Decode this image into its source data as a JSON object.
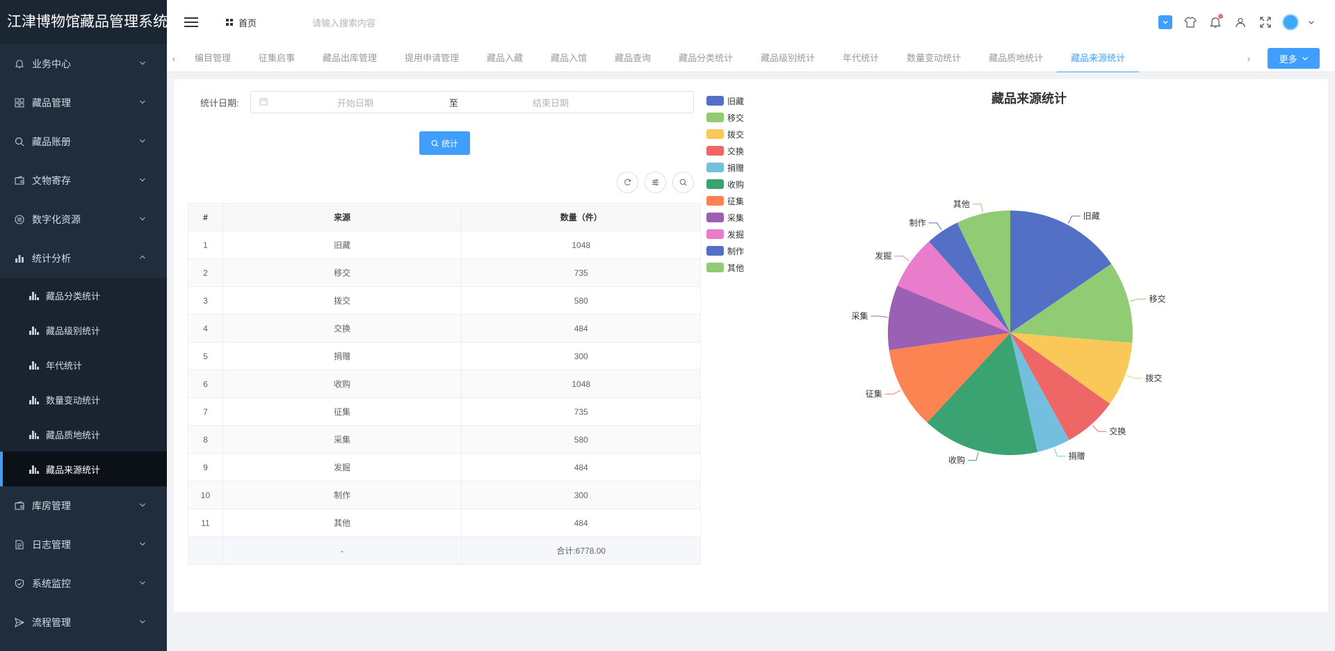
{
  "app_title": "江津博物馆藏品管理系统",
  "sidebar": {
    "items": [
      {
        "label": "业务中心",
        "icon": "bell-icon",
        "expanded": false
      },
      {
        "label": "藏品管理",
        "icon": "grid-icon",
        "expanded": false
      },
      {
        "label": "藏品账册",
        "icon": "search-icon",
        "expanded": false
      },
      {
        "label": "文物寄存",
        "icon": "wallet-icon",
        "expanded": false
      },
      {
        "label": "数字化资源",
        "icon": "list-icon",
        "expanded": false
      },
      {
        "label": "统计分析",
        "icon": "bar-chart-icon",
        "expanded": true
      },
      {
        "label": "库房管理",
        "icon": "wallet-icon",
        "expanded": false
      },
      {
        "label": "日志管理",
        "icon": "document-icon",
        "expanded": false
      },
      {
        "label": "系统监控",
        "icon": "shield-icon",
        "expanded": false
      },
      {
        "label": "流程管理",
        "icon": "send-icon",
        "expanded": false
      }
    ],
    "submenu": [
      {
        "label": "藏品分类统计",
        "active": false
      },
      {
        "label": "藏品级别统计",
        "active": false
      },
      {
        "label": "年代统计",
        "active": false
      },
      {
        "label": "数量变动统计",
        "active": false
      },
      {
        "label": "藏品质地统计",
        "active": false
      },
      {
        "label": "藏品来源统计",
        "active": true
      }
    ]
  },
  "header": {
    "home_label": "首页",
    "search_placeholder": "请输入搜索内容"
  },
  "tabs": {
    "items": [
      "编目管理",
      "征集启事",
      "藏品出库管理",
      "提用申请管理",
      "藏品入藏",
      "藏品入馆",
      "藏品查询",
      "藏品分类统计",
      "藏品级别统计",
      "年代统计",
      "数量变动统计",
      "藏品质地统计",
      "藏品来源统计"
    ],
    "active_index": 12,
    "more_label": "更多"
  },
  "form": {
    "date_label": "统计日期:",
    "start_placeholder": "开始日期",
    "separator": "至",
    "end_placeholder": "结束日期",
    "submit_label": "统计"
  },
  "table": {
    "headers": [
      "#",
      "来源",
      "数量（件）"
    ],
    "rows": [
      [
        "1",
        "旧藏",
        "1048"
      ],
      [
        "2",
        "移交",
        "735"
      ],
      [
        "3",
        "拨交",
        "580"
      ],
      [
        "4",
        "交换",
        "484"
      ],
      [
        "5",
        "捐赠",
        "300"
      ],
      [
        "6",
        "收购",
        "1048"
      ],
      [
        "7",
        "征集",
        "735"
      ],
      [
        "8",
        "采集",
        "580"
      ],
      [
        "9",
        "发掘",
        "484"
      ],
      [
        "10",
        "制作",
        "300"
      ],
      [
        "11",
        "其他",
        "484"
      ]
    ],
    "summary": [
      "",
      "-",
      "合计:6778.00"
    ]
  },
  "chart_data": {
    "type": "pie",
    "title": "藏品来源统计",
    "categories": [
      "旧藏",
      "移交",
      "拨交",
      "交换",
      "捐赠",
      "收购",
      "征集",
      "采集",
      "发掘",
      "制作",
      "其他"
    ],
    "values": [
      1048,
      735,
      580,
      484,
      300,
      1048,
      735,
      580,
      484,
      300,
      484
    ],
    "colors": [
      "#5470c6",
      "#91cc75",
      "#fac858",
      "#ee6666",
      "#73c0de",
      "#3ba272",
      "#fc8452",
      "#9a60b4",
      "#ea7ccc",
      "#5470c6",
      "#91cc75"
    ],
    "legend_position": "left"
  }
}
